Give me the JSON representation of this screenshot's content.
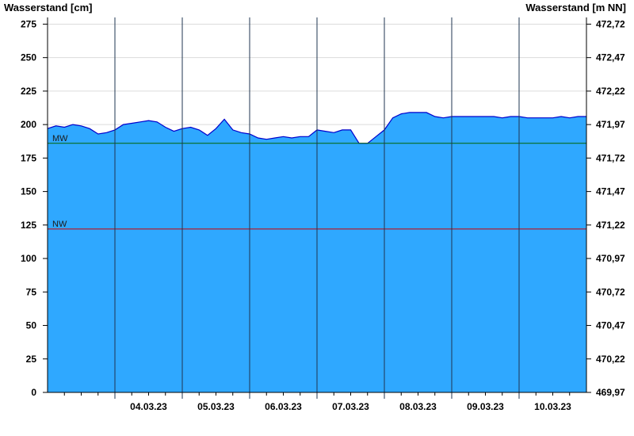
{
  "chart_data": {
    "type": "area",
    "title": "",
    "y_left_label": "Wasserstand [cm]",
    "y_right_label": "Wasserstand [m NN]",
    "ylim": [
      0,
      280
    ],
    "y_left_ticks": [
      0,
      25,
      50,
      75,
      100,
      125,
      150,
      175,
      200,
      225,
      250,
      275
    ],
    "y_right_ticks": [
      "469,97",
      "470,22",
      "470,47",
      "470,72",
      "470,97",
      "471,22",
      "471,47",
      "471,72",
      "471,97",
      "472,22",
      "472,47",
      "472,72"
    ],
    "x_range_days": [
      "03.03.23",
      "10.03.23"
    ],
    "x_ticks": [
      "04.03.23",
      "05.03.23",
      "06.03.23",
      "07.03.23",
      "08.03.23",
      "09.03.23",
      "10.03.23"
    ],
    "grid": "horizontal",
    "area_color": "#2fa8ff",
    "line_color": "#0000cc",
    "reference_lines": [
      {
        "label": "MW",
        "value": 186,
        "color": "#006400"
      },
      {
        "label": "NW",
        "value": 122,
        "color": "#cc0000"
      }
    ],
    "series": [
      {
        "points": [
          [
            "03.03.23 00:00",
            197
          ],
          [
            "03.03.23 03:00",
            199
          ],
          [
            "03.03.23 06:00",
            198
          ],
          [
            "03.03.23 09:00",
            200
          ],
          [
            "03.03.23 12:00",
            199
          ],
          [
            "03.03.23 15:00",
            197
          ],
          [
            "03.03.23 18:00",
            193
          ],
          [
            "03.03.23 21:00",
            194
          ],
          [
            "04.03.23 00:00",
            196
          ],
          [
            "04.03.23 03:00",
            200
          ],
          [
            "04.03.23 06:00",
            201
          ],
          [
            "04.03.23 09:00",
            202
          ],
          [
            "04.03.23 12:00",
            203
          ],
          [
            "04.03.23 15:00",
            202
          ],
          [
            "04.03.23 18:00",
            198
          ],
          [
            "04.03.23 21:00",
            195
          ],
          [
            "05.03.23 00:00",
            197
          ],
          [
            "05.03.23 03:00",
            198
          ],
          [
            "05.03.23 06:00",
            196
          ],
          [
            "05.03.23 09:00",
            192
          ],
          [
            "05.03.23 12:00",
            197
          ],
          [
            "05.03.23 15:00",
            204
          ],
          [
            "05.03.23 18:00",
            196
          ],
          [
            "05.03.23 21:00",
            194
          ],
          [
            "06.03.23 00:00",
            193
          ],
          [
            "06.03.23 03:00",
            190
          ],
          [
            "06.03.23 06:00",
            189
          ],
          [
            "06.03.23 09:00",
            190
          ],
          [
            "06.03.23 12:00",
            191
          ],
          [
            "06.03.23 15:00",
            190
          ],
          [
            "06.03.23 18:00",
            191
          ],
          [
            "06.03.23 21:00",
            191
          ],
          [
            "07.03.23 00:00",
            196
          ],
          [
            "07.03.23 03:00",
            195
          ],
          [
            "07.03.23 06:00",
            194
          ],
          [
            "07.03.23 09:00",
            196
          ],
          [
            "07.03.23 12:00",
            196
          ],
          [
            "07.03.23 15:00",
            186
          ],
          [
            "07.03.23 18:00",
            186
          ],
          [
            "07.03.23 21:00",
            191
          ],
          [
            "08.03.23 00:00",
            196
          ],
          [
            "08.03.23 03:00",
            205
          ],
          [
            "08.03.23 06:00",
            208
          ],
          [
            "08.03.23 09:00",
            209
          ],
          [
            "08.03.23 12:00",
            209
          ],
          [
            "08.03.23 15:00",
            209
          ],
          [
            "08.03.23 18:00",
            206
          ],
          [
            "08.03.23 21:00",
            205
          ],
          [
            "09.03.23 00:00",
            206
          ],
          [
            "09.03.23 03:00",
            206
          ],
          [
            "09.03.23 06:00",
            206
          ],
          [
            "09.03.23 09:00",
            206
          ],
          [
            "09.03.23 12:00",
            206
          ],
          [
            "09.03.23 15:00",
            206
          ],
          [
            "09.03.23 18:00",
            205
          ],
          [
            "09.03.23 21:00",
            206
          ],
          [
            "10.03.23 00:00",
            206
          ],
          [
            "10.03.23 03:00",
            205
          ],
          [
            "10.03.23 06:00",
            205
          ],
          [
            "10.03.23 09:00",
            205
          ],
          [
            "10.03.23 12:00",
            205
          ],
          [
            "10.03.23 15:00",
            206
          ],
          [
            "10.03.23 18:00",
            205
          ],
          [
            "10.03.23 21:00",
            206
          ]
        ]
      }
    ]
  }
}
